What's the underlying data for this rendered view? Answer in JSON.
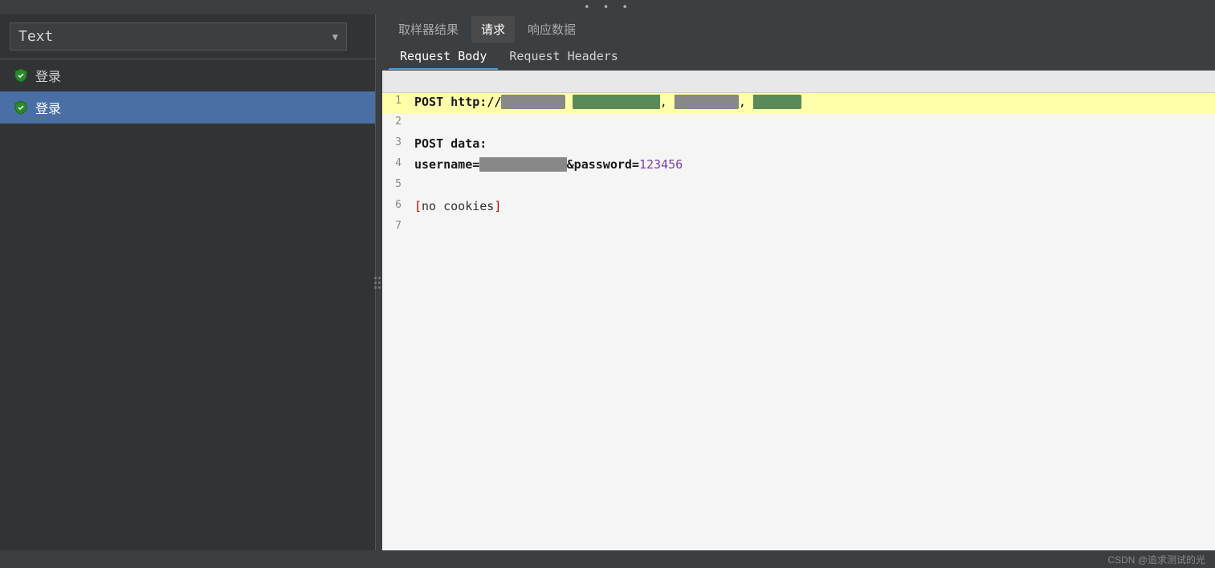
{
  "topBar": {
    "dots": 3
  },
  "leftPanel": {
    "dropdownLabel": "Text",
    "items": [
      {
        "label": "登录",
        "selected": false
      },
      {
        "label": "登录",
        "selected": true
      }
    ]
  },
  "rightPanel": {
    "tabsTop": [
      {
        "label": "取样器结果",
        "active": false
      },
      {
        "label": "请求",
        "active": true
      },
      {
        "label": "响应数据",
        "active": false
      }
    ],
    "tabsSub": [
      {
        "label": "Request Body",
        "active": true
      },
      {
        "label": "Request Headers",
        "active": false
      }
    ],
    "codeLines": [
      {
        "num": "1",
        "highlighted": true,
        "parts": [
          {
            "text": "POST http://",
            "class": "kw-method"
          },
          {
            "text": "██████",
            "class": "url-blurred"
          },
          {
            "text": " ",
            "class": ""
          },
          {
            "text": "██████████",
            "class": "url-green-blurred"
          },
          {
            "text": " ",
            "class": ""
          },
          {
            "text": "██████",
            "class": "url-blurred"
          },
          {
            "text": " ",
            "class": ""
          },
          {
            "text": "████",
            "class": "url-green-blurred"
          }
        ]
      },
      {
        "num": "2",
        "highlighted": false,
        "parts": []
      },
      {
        "num": "3",
        "highlighted": false,
        "parts": [
          {
            "text": "POST data:",
            "class": "kw-key"
          }
        ]
      },
      {
        "num": "4",
        "highlighted": false,
        "parts": [
          {
            "text": "username=",
            "class": "kw-key"
          },
          {
            "text": "████████",
            "class": "url-blurred"
          },
          {
            "text": "&password=",
            "class": "kw-key"
          },
          {
            "text": "123456",
            "class": "kw-password-value"
          }
        ]
      },
      {
        "num": "5",
        "highlighted": false,
        "parts": []
      },
      {
        "num": "6",
        "highlighted": false,
        "parts": [
          {
            "text": "[",
            "class": "kw-bracket-red"
          },
          {
            "text": "no cookies",
            "class": "kw-no-cookies"
          },
          {
            "text": "]",
            "class": "kw-bracket-red"
          }
        ]
      },
      {
        "num": "7",
        "highlighted": false,
        "parts": []
      }
    ]
  },
  "bottomBar": {
    "watermark": "CSDN @追求测试的光"
  }
}
